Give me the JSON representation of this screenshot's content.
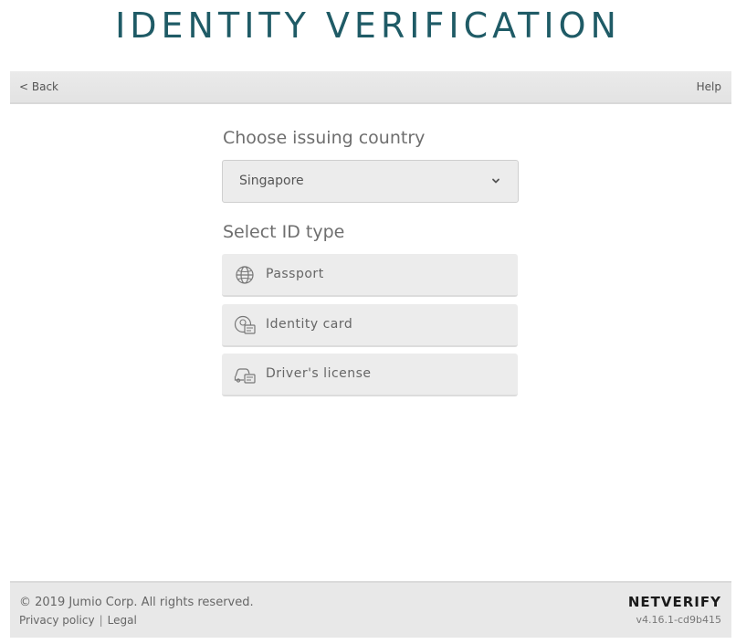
{
  "header": {
    "title": "IDENTITY VERIFICATION"
  },
  "nav": {
    "back_label": "< Back",
    "help_label": "Help"
  },
  "country": {
    "heading": "Choose issuing country",
    "selected": "Singapore",
    "icon": "chevron-down-icon"
  },
  "id_type": {
    "heading": "Select ID type",
    "options": [
      {
        "label": "Passport",
        "icon": "globe-icon"
      },
      {
        "label": "Identity card",
        "icon": "id-card-icon"
      },
      {
        "label": "Driver's license",
        "icon": "car-license-icon"
      }
    ]
  },
  "footer": {
    "copyright": "© 2019 Jumio Corp. All rights reserved.",
    "privacy_label": "Privacy policy",
    "separator": "|",
    "legal_label": "Legal",
    "brand": "NETVERIFY",
    "version": "v4.16.1-cd9b415"
  },
  "colors": {
    "title": "#1f5b66",
    "option_bg": "#ececec",
    "footer_bg": "#e8e8e8"
  }
}
